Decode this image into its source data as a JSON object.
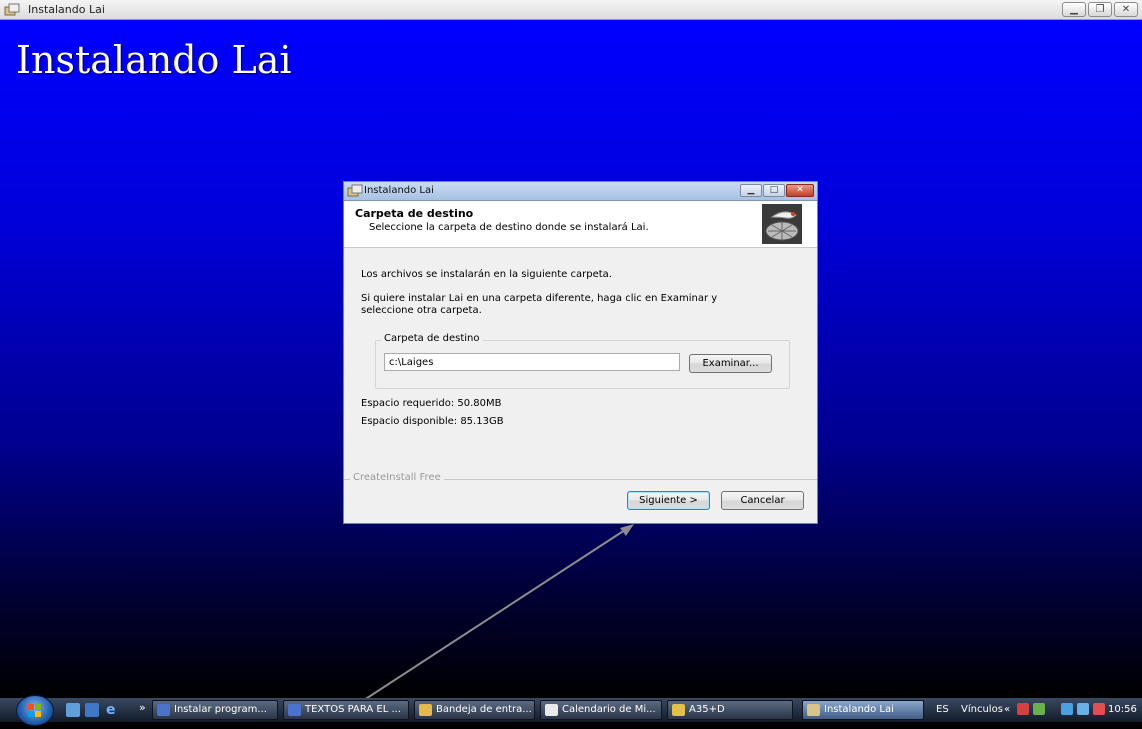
{
  "window": {
    "title": "Instalando Lai",
    "minimize_icon": "minimize-icon",
    "maximize_icon": "restore-icon",
    "close_icon": "close-icon"
  },
  "background": {
    "title": "Instalando Lai"
  },
  "dialog": {
    "title": "Instalando Lai",
    "header_title": "Carpeta de destino",
    "header_subtitle": "Seleccione la carpeta de destino donde se instalará Lai.",
    "intro_text": "Los archivos se instalarán en la siguiente carpeta.",
    "change_text_line1": "Si quiere instalar Lai en una carpeta diferente, haga clic en Examinar y",
    "change_text_line2": "seleccione otra carpeta.",
    "group_label": "Carpeta de destino",
    "path_value": "c:\\Laiges",
    "browse_label": "Examinar...",
    "space_required": "Espacio requerido: 50.80MB",
    "space_available": "Espacio disponible: 85.13GB",
    "footer_brand": "CreateInstall Free",
    "next_label": "Siguiente >",
    "cancel_label": "Cancelar"
  },
  "taskbar": {
    "quicklaunch_chevron": "»",
    "items": [
      {
        "label": "Instalar program...",
        "icon": "word-doc-icon"
      },
      {
        "label": "TEXTOS PARA EL ...",
        "icon": "word-doc-icon"
      },
      {
        "label": "Bandeja de entra...",
        "icon": "mail-inbox-icon"
      },
      {
        "label": "Calendario de Mi...",
        "icon": "calendar-icon"
      },
      {
        "label": "A35+D",
        "icon": "folder-icon"
      },
      {
        "label": "Instalando Lai",
        "icon": "installer-icon"
      }
    ],
    "language": "ES",
    "links_label": "Vínculos",
    "links_chevron": "«",
    "clock": "10:56"
  },
  "colors": {
    "desktop_top": "#0000ff",
    "desktop_bottom": "#000000",
    "taskbar": "#1e2839",
    "dialog_bg": "#f0f0f0",
    "default_button_border": "#3c7fb1"
  }
}
